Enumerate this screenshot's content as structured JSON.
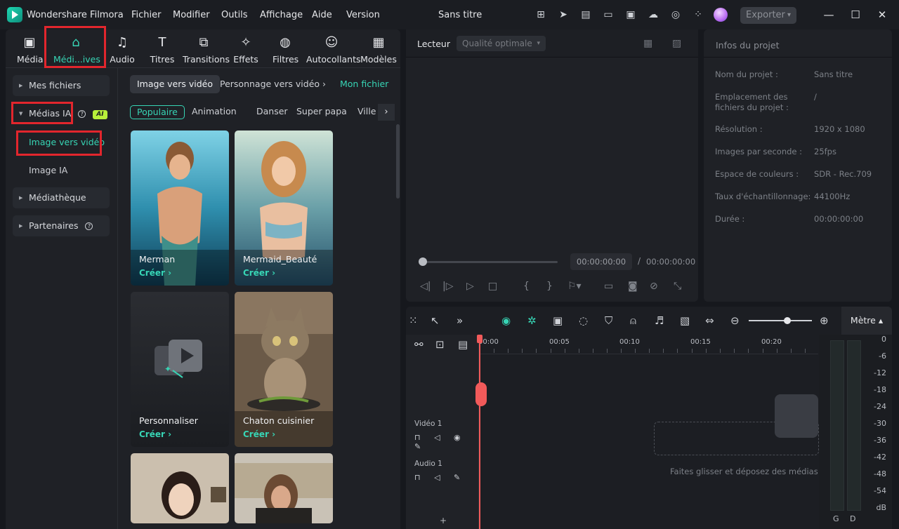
{
  "app": {
    "name": "Wondershare Filmora",
    "document_title": "Sans titre",
    "menu": [
      "Fichier",
      "Modifier",
      "Outils",
      "Affichage",
      "Aide",
      "Version"
    ],
    "export_label": "Exporter"
  },
  "toolbar": {
    "tools": [
      {
        "label": "Média",
        "icon": "media-icon"
      },
      {
        "label": "Médi...ives",
        "icon": "store-icon"
      },
      {
        "label": "Audio",
        "icon": "music-note-icon"
      },
      {
        "label": "Titres",
        "icon": "title-t-icon"
      },
      {
        "label": "Transitions",
        "icon": "transitions-icon"
      },
      {
        "label": "Effets",
        "icon": "effects-star-icon"
      },
      {
        "label": "Filtres",
        "icon": "filters-icon"
      },
      {
        "label": "Autocollants",
        "icon": "sticker-icon"
      },
      {
        "label": "Modèles",
        "icon": "templates-icon"
      }
    ]
  },
  "sidebar": {
    "mes_fichiers": "Mes fichiers",
    "medias_ia": "Médias IA",
    "ai_badge": "AI",
    "image_vers_video": "Image vers vidéo",
    "image_ia": "Image IA",
    "mediatheque": "Médiathèque",
    "partenaires": "Partenaires"
  },
  "content": {
    "tabs": [
      "Image vers vidéo",
      "Personnage vers vidéo"
    ],
    "mon_fichier": "Mon fichier",
    "chips": [
      "Populaire",
      "Animation",
      "Danser",
      "Super papa",
      "Ville"
    ],
    "cards": [
      {
        "name": "Merman",
        "action": "Créer"
      },
      {
        "name": "Mermaid_Beauté",
        "action": "Créer"
      },
      {
        "name": "Personnaliser",
        "action": "Créer"
      },
      {
        "name": "Chaton cuisinier",
        "action": "Créer"
      }
    ]
  },
  "player": {
    "label": "Lecteur",
    "quality": "Qualité optimale",
    "current_time": "00:00:00:00",
    "total_time": "00:00:00:00",
    "separator": "/"
  },
  "project_info": {
    "title": "Infos du projet",
    "fields": [
      {
        "label": "Nom du projet :",
        "value": "Sans titre"
      },
      {
        "label": "Emplacement des fichiers du projet :",
        "value": "/"
      },
      {
        "label": "Résolution :",
        "value": "1920 x 1080"
      },
      {
        "label": "Images par seconde :",
        "value": "25fps"
      },
      {
        "label": "Espace de couleurs :",
        "value": "SDR - Rec.709"
      },
      {
        "label": "Taux d'échantillonnage:",
        "value": "44100Hz"
      },
      {
        "label": "Durée :",
        "value": "00:00:00:00"
      }
    ]
  },
  "timeline": {
    "metre_label": "Mètre",
    "ruler": [
      "00:00",
      "00:05",
      "00:10",
      "00:15",
      "00:20"
    ],
    "video_track": "Vidéo 1",
    "audio_track": "Audio 1",
    "drop_text": "Faites glisser et déposez des médias et des effets ici pour créer votre vidéo.",
    "add_track": "+",
    "vu_scale": [
      "0",
      "-6",
      "-12",
      "-18",
      "-24",
      "-30",
      "-36",
      "-42",
      "-48",
      "-54",
      "dB"
    ],
    "vu_channels": [
      "G",
      "D"
    ]
  }
}
